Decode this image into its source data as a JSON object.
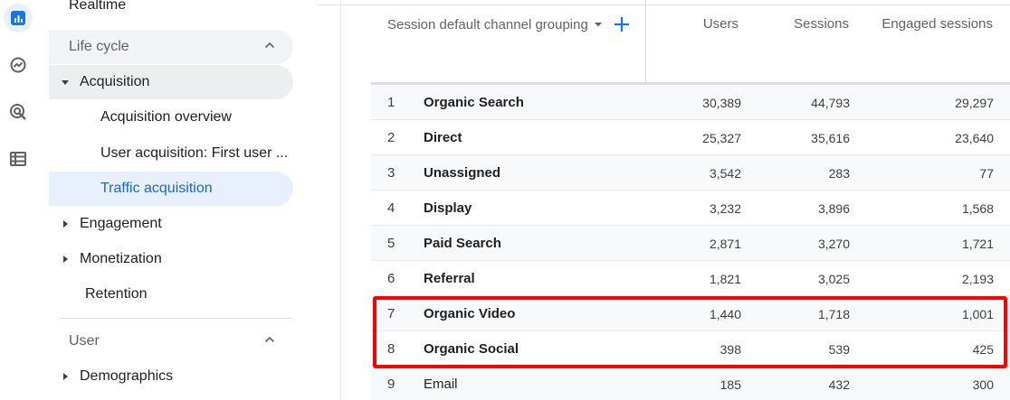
{
  "sidebar": {
    "realtime_label": "Realtime",
    "lifecycle_label": "Life cycle",
    "acquisition_label": "Acquisition",
    "sub_items": [
      "Acquisition overview",
      "User acquisition: First user ...",
      "Traffic acquisition"
    ],
    "engagement_label": "Engagement",
    "monetization_label": "Monetization",
    "retention_label": "Retention",
    "user_label": "User",
    "demographics_label": "Demographics"
  },
  "rail": {
    "icons": [
      "reports-icon",
      "explore-icon",
      "advertising-icon",
      "configure-icon"
    ]
  },
  "table": {
    "dimension_header": "Session default channel grouping",
    "columns": [
      "Users",
      "Sessions",
      "Engaged sessions"
    ],
    "rows": [
      {
        "idx": "1",
        "name": "Organic Search",
        "users": "30,389",
        "sessions": "44,793",
        "engaged": "29,297"
      },
      {
        "idx": "2",
        "name": "Direct",
        "users": "25,327",
        "sessions": "35,616",
        "engaged": "23,640"
      },
      {
        "idx": "3",
        "name": "Unassigned",
        "users": "3,542",
        "sessions": "283",
        "engaged": "77"
      },
      {
        "idx": "4",
        "name": "Display",
        "users": "3,232",
        "sessions": "3,896",
        "engaged": "1,568"
      },
      {
        "idx": "5",
        "name": "Paid Search",
        "users": "2,871",
        "sessions": "3,270",
        "engaged": "1,721"
      },
      {
        "idx": "6",
        "name": "Referral",
        "users": "1,821",
        "sessions": "3,025",
        "engaged": "2,193"
      },
      {
        "idx": "7",
        "name": "Organic Video",
        "users": "1,440",
        "sessions": "1,718",
        "engaged": "1,001"
      },
      {
        "idx": "8",
        "name": "Organic Social",
        "users": "398",
        "sessions": "539",
        "engaged": "425"
      },
      {
        "idx": "9",
        "name": "Email",
        "users": "185",
        "sessions": "432",
        "engaged": "300"
      }
    ]
  },
  "colors": {
    "accent": "#1a73e8",
    "active_bg": "#e8f0fe",
    "highlight": "#ff0000"
  }
}
